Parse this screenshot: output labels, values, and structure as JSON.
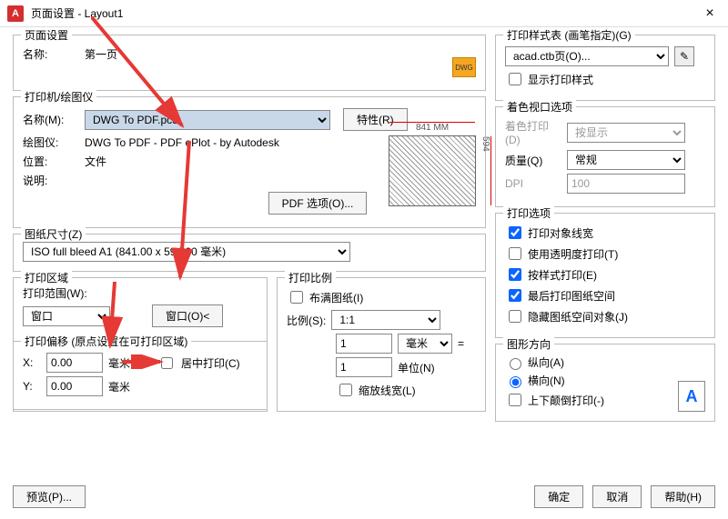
{
  "window": {
    "title": "页面设置 - Layout1",
    "close": "×",
    "logo": "A"
  },
  "pageSetup": {
    "group": "页面设置",
    "nameLabel": "名称:",
    "nameValue": "第一页"
  },
  "printer": {
    "group": "打印机/绘图仪",
    "nameLabel": "名称(M):",
    "nameValue": "DWG To PDF.pc3",
    "propsBtn": "特性(R)",
    "plotterLabel": "绘图仪:",
    "plotterValue": "DWG To PDF - PDF ePlot - by Autodesk",
    "whereLabel": "位置:",
    "whereValue": "文件",
    "descLabel": "说明:",
    "pdfOptBtn": "PDF 选项(O)...",
    "dimTop": "841 MM",
    "dimRight": "594"
  },
  "paperSize": {
    "group": "图纸尺寸(Z)",
    "value": "ISO full bleed A1 (841.00 x 594.00 毫米)"
  },
  "plotArea": {
    "group": "打印区域",
    "rangeLabel": "打印范围(W):",
    "rangeValue": "窗口",
    "windowBtn": "窗口(O)<"
  },
  "offset": {
    "group": "打印偏移 (原点设置在可打印区域)",
    "xLabel": "X:",
    "xValue": "0.00",
    "xUnit": "毫米",
    "yLabel": "Y:",
    "yValue": "0.00",
    "yUnit": "毫米",
    "centerLabel": "居中打印(C)"
  },
  "plotScale": {
    "group": "打印比例",
    "fitLabel": "布满图纸(I)",
    "scaleLabel": "比例(S):",
    "scaleValue": "1:1",
    "mmValue": "1",
    "mmUnit": "毫米",
    "eq": "=",
    "unitValue": "1",
    "unitUnit": "单位(N)",
    "lwLabel": "缩放线宽(L)"
  },
  "styleTable": {
    "group": "打印样式表 (画笔指定)(G)",
    "value": "acad.ctb页(O)...",
    "displayLabel": "显示打印样式"
  },
  "shaded": {
    "group": "着色视口选项",
    "shadeLabel": "着色打印(D)",
    "shadeValue": "按显示",
    "qualityLabel": "质量(Q)",
    "qualityValue": "常规",
    "dpiLabel": "DPI",
    "dpiValue": "100"
  },
  "plotOptions": {
    "group": "打印选项",
    "opt1": "打印对象线宽",
    "opt2": "使用透明度打印(T)",
    "opt3": "按样式打印(E)",
    "opt4": "最后打印图纸空间",
    "opt5": "隐藏图纸空间对象(J)"
  },
  "orientation": {
    "group": "图形方向",
    "portrait": "纵向(A)",
    "landscape": "横向(N)",
    "upsideDown": "上下颠倒打印(-)",
    "icon": "A"
  },
  "footer": {
    "preview": "预览(P)...",
    "ok": "确定",
    "cancel": "取消",
    "help": "帮助(H)"
  }
}
